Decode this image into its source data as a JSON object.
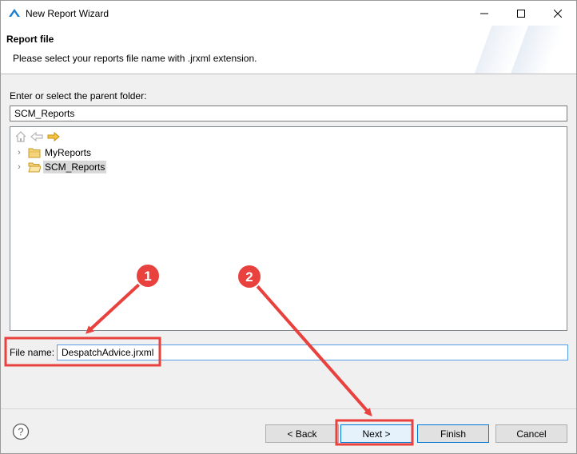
{
  "window": {
    "title": "New Report Wizard"
  },
  "header": {
    "title": "Report file",
    "subtitle": "Please select your reports file name with .jrxml extension."
  },
  "parent_folder": {
    "label": "Enter or select the parent folder:",
    "value": "SCM_Reports"
  },
  "tree": {
    "items": [
      {
        "label": "MyReports",
        "selected": false
      },
      {
        "label": "SCM_Reports",
        "selected": true
      }
    ]
  },
  "file_name": {
    "label": "File name:",
    "value": "DespatchAdvice.jrxml"
  },
  "buttons": {
    "back": "< Back",
    "next": "Next >",
    "finish": "Finish",
    "cancel": "Cancel"
  },
  "annotations": {
    "callout_1": "1",
    "callout_2": "2",
    "color": "#e8413e"
  }
}
